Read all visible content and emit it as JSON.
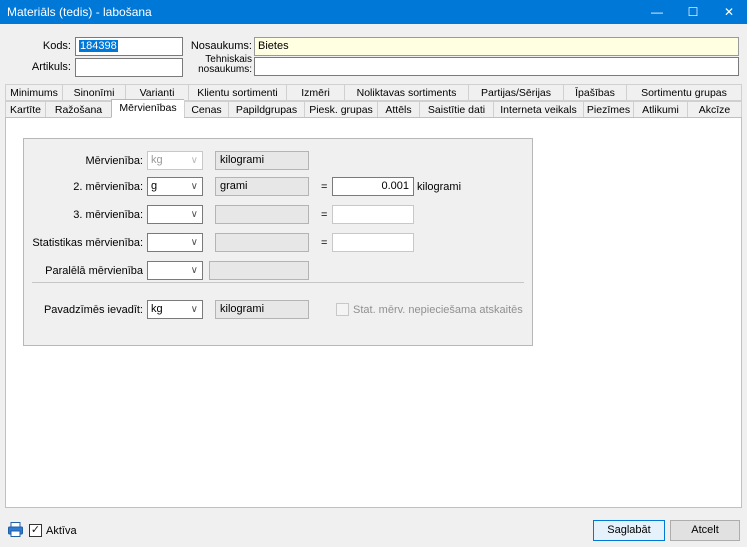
{
  "window": {
    "title": "Materiāls (tedis) - labošana",
    "minimize": "—",
    "maximize": "☐",
    "close": "✕"
  },
  "header": {
    "kods_label": "Kods:",
    "kods_value": "184398",
    "artikuls_label": "Artikuls:",
    "artikuls_value": "",
    "nosaukums_label": "Nosaukums:",
    "nosaukums_value": "Bietes",
    "teh_label_1": "Tehniskais",
    "teh_label_2": "nosaukums:",
    "teh_value": ""
  },
  "tabs_row1": [
    "Minimums",
    "Sinonīmi",
    "Varianti",
    "Klientu sortimenti",
    "Izmēri",
    "Noliktavas sortiments",
    "Partijas/Sērijas",
    "Īpašības",
    "Sortimentu grupas"
  ],
  "tabs_row2": [
    "Kartīte",
    "Ražošana",
    "Mērvienības",
    "Cenas",
    "Papildgrupas",
    "Piesk. grupas",
    "Attēls",
    "Saistītie dati",
    "Interneta veikals",
    "Piezīmes",
    "Atlikumi",
    "Akcīze"
  ],
  "active_tab": "Mērvienības",
  "form": {
    "mervieniba_label": "Mērvienība:",
    "mervieniba_value": "kg",
    "mervieniba_name": "kilogrami",
    "mervieniba2_label": "2. mērvienība:",
    "mervieniba2_value": "g",
    "mervieniba2_name": "grami",
    "mervieniba2_factor": "0.001",
    "mervieniba2_unit": "kilogrami",
    "mervieniba3_label": "3. mērvienība:",
    "stat_label": "Statistikas mērvienība:",
    "paralela_label": "Paralēlā mērvienība",
    "eq": "=",
    "pavadzimes_label": "Pavadzīmēs ievadīt:",
    "pavadzimes_value": "kg",
    "pavadzimes_name": "kilogrami",
    "stat_checkbox_label": "Stat. mērv. nepieciešama atskaitēs"
  },
  "footer": {
    "aktiva_label": "Aktīva",
    "save_label": "Saglabāt",
    "cancel_label": "Atcelt"
  }
}
